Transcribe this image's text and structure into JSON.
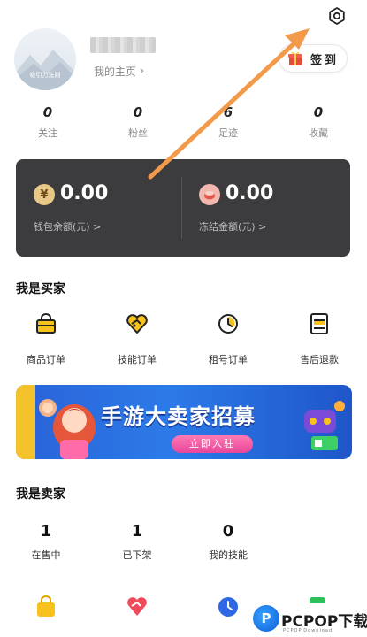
{
  "profile": {
    "avatar_caption": "吸引力法则",
    "homepage_link": "我的主页",
    "checkin_label": "签到"
  },
  "stats": [
    {
      "value": "0",
      "label": "关注"
    },
    {
      "value": "0",
      "label": "粉丝"
    },
    {
      "value": "6",
      "label": "足迹"
    },
    {
      "value": "0",
      "label": "收藏"
    }
  ],
  "wallet": {
    "balance_amount": "0.00",
    "balance_label": "钱包余额(元) >",
    "balance_coin": "¥",
    "frozen_amount": "0.00",
    "frozen_label": "冻结金额(元) >"
  },
  "buyer": {
    "title": "我是买家",
    "items": [
      {
        "label": "商品订单",
        "icon": "bag-icon"
      },
      {
        "label": "技能订单",
        "icon": "heart-tag-icon"
      },
      {
        "label": "租号订单",
        "icon": "clock-icon"
      },
      {
        "label": "售后退款",
        "icon": "document-icon"
      }
    ]
  },
  "banner": {
    "title": "手游大卖家招募",
    "cta": "立即入驻"
  },
  "seller": {
    "title": "我是卖家",
    "stats": [
      {
        "value": "1",
        "label": "在售中"
      },
      {
        "value": "1",
        "label": "已下架"
      },
      {
        "value": "0",
        "label": "我的技能"
      }
    ]
  },
  "watermark": {
    "logo_letter": "P",
    "text": "PCPOP下载",
    "sub": "PCPOP.Download"
  },
  "colors": {
    "accent_orange": "#f39a4a",
    "wallet_bg": "#3c3c3e",
    "banner_blue": "#2a62d8",
    "icon_yellow": "#f7c21e",
    "icon_red": "#ef4b5a",
    "icon_blue": "#2f68e6",
    "icon_green": "#2fbf5a"
  }
}
